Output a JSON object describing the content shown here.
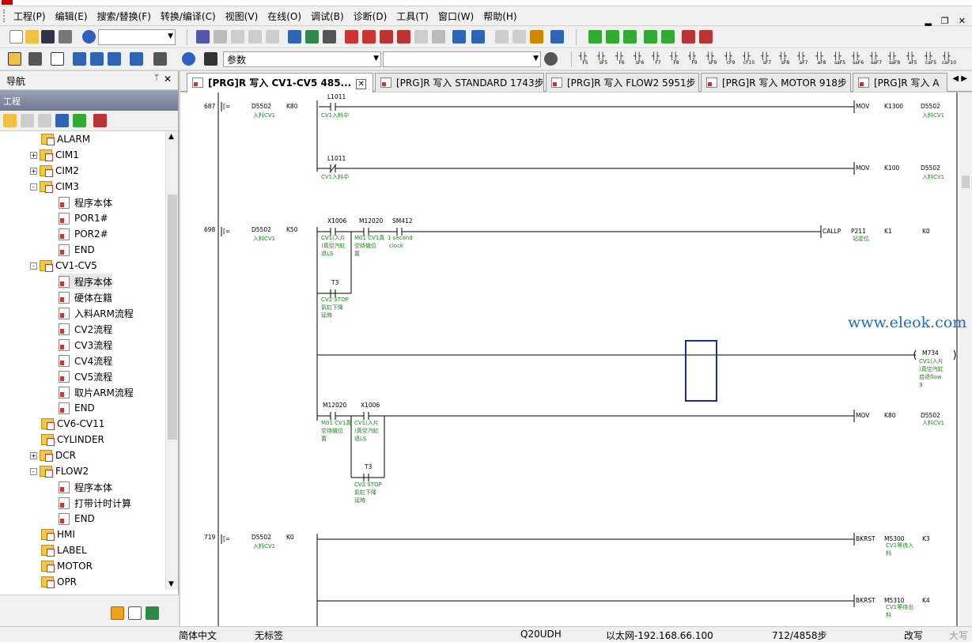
{
  "menu": [
    "工程(P)",
    "编辑(E)",
    "搜索/替换(F)",
    "转换/编译(C)",
    "视图(V)",
    "在线(O)",
    "调试(B)",
    "诊断(D)",
    "工具(T)",
    "窗口(W)",
    "帮助(H)"
  ],
  "toolbar": {
    "search_combo": "参数"
  },
  "fkeys": [
    "F5",
    "sF5",
    "F6",
    "sF6",
    "F7",
    "F8",
    "F9",
    "sF9",
    "cF9",
    "cF10",
    "sF7",
    "sF8",
    "aF7",
    "aF8",
    "saF5",
    "saF6",
    "saF7",
    "saF8",
    "aF5",
    "caF5",
    "caF10"
  ],
  "nav": {
    "title": "导航",
    "project_header": "工程",
    "tree": [
      {
        "label": "ALARM",
        "level": 2,
        "kind": "folder"
      },
      {
        "label": "CIM1",
        "level": 1,
        "kind": "folder",
        "exp": "+"
      },
      {
        "label": "CIM2",
        "level": 1,
        "kind": "folder",
        "exp": "+"
      },
      {
        "label": "CIM3",
        "level": 1,
        "kind": "folder",
        "exp": "-"
      },
      {
        "label": "程序本体",
        "level": 3,
        "kind": "doc"
      },
      {
        "label": "POR1#",
        "level": 3,
        "kind": "doc"
      },
      {
        "label": "POR2#",
        "level": 3,
        "kind": "doc"
      },
      {
        "label": "END",
        "level": 3,
        "kind": "doc"
      },
      {
        "label": "CV1-CV5",
        "level": 1,
        "kind": "folder",
        "exp": "-"
      },
      {
        "label": "程序本体",
        "level": 3,
        "kind": "doc",
        "selected": true
      },
      {
        "label": "硬体在籍",
        "level": 3,
        "kind": "doc"
      },
      {
        "label": "入料ARM流程",
        "level": 3,
        "kind": "doc"
      },
      {
        "label": "CV2流程",
        "level": 3,
        "kind": "doc"
      },
      {
        "label": "CV3流程",
        "level": 3,
        "kind": "doc"
      },
      {
        "label": "CV4流程",
        "level": 3,
        "kind": "doc"
      },
      {
        "label": "CV5流程",
        "level": 3,
        "kind": "doc"
      },
      {
        "label": "取片ARM流程",
        "level": 3,
        "kind": "doc"
      },
      {
        "label": "END",
        "level": 3,
        "kind": "doc"
      },
      {
        "label": "CV6-CV11",
        "level": 2,
        "kind": "folder"
      },
      {
        "label": "CYLINDER",
        "level": 2,
        "kind": "folder"
      },
      {
        "label": "DCR",
        "level": 1,
        "kind": "folder",
        "exp": "+"
      },
      {
        "label": "FLOW2",
        "level": 1,
        "kind": "folder",
        "exp": "-"
      },
      {
        "label": "程序本体",
        "level": 3,
        "kind": "doc"
      },
      {
        "label": "打带计时计算",
        "level": 3,
        "kind": "doc"
      },
      {
        "label": "END",
        "level": 3,
        "kind": "doc"
      },
      {
        "label": "HMI",
        "level": 2,
        "kind": "folder"
      },
      {
        "label": "LABEL",
        "level": 2,
        "kind": "folder"
      },
      {
        "label": "MOTOR",
        "level": 2,
        "kind": "folder"
      },
      {
        "label": "OPR",
        "level": 2,
        "kind": "folder"
      }
    ]
  },
  "tabs": [
    {
      "label": "[PRG]R 写入 CV1-CV5 485...",
      "active": true
    },
    {
      "label": "[PRG]R 写入 STANDARD 1743步"
    },
    {
      "label": "[PRG]R 写入 FLOW2 5951步"
    },
    {
      "label": "[PRG]R 写入 MOTOR 918步"
    },
    {
      "label": "[PRG]R 写入 A"
    }
  ],
  "ladder": {
    "steps": [
      "687",
      "698",
      "719"
    ],
    "eq": "[=",
    "texts": {
      "d5502": "D5502",
      "k80": "K80",
      "k50": "K50",
      "k0": "K0",
      "in_cv1": "入料CV1",
      "l1011": "L1011",
      "cv1_in": "CV1入料中",
      "mov": "MOV",
      "k1300": "K1300",
      "k100": "K100",
      "x1006": "X1006",
      "m12020": "M12020",
      "sm412": "SM412",
      "cv1_a": "CV1(入片",
      "cv1_b": ")真空汽缸",
      "cv1_c": "退LS",
      "m01_a": "M01 CV1真",
      "m01_b": "空待機位",
      "m01_c": "置",
      "sec_a": "1 second",
      "sec_b": "clock",
      "callp": "CALLP",
      "p211": "P211",
      "p211c": "站定位",
      "k1": "K1",
      "t3": "T3",
      "cv2_a": "CV2 STOP",
      "cv2_b": "氣缸下降",
      "cv2_c": "延時",
      "m734": "M734",
      "m734a": "CV1(入片",
      "m734b": ")真空汽缸",
      "m734c": "启退flow",
      "m734d": "3",
      "bkrst": "BKRST",
      "m5300": "M5300",
      "m5300a": "CV1等待入",
      "m5300b": "料",
      "k3": "K3",
      "m5310": "M5310",
      "m5310a": "CV1等待出",
      "m5310b": "料",
      "k4": "K4"
    }
  },
  "watermark": "www.eleok.com",
  "status": {
    "lang": "简体中文",
    "label": "无标签",
    "cpu": "Q20UDH",
    "conn": "以太网-192.168.66.100",
    "steps": "712/4858步",
    "mode": "改写",
    "caps": "大写"
  }
}
